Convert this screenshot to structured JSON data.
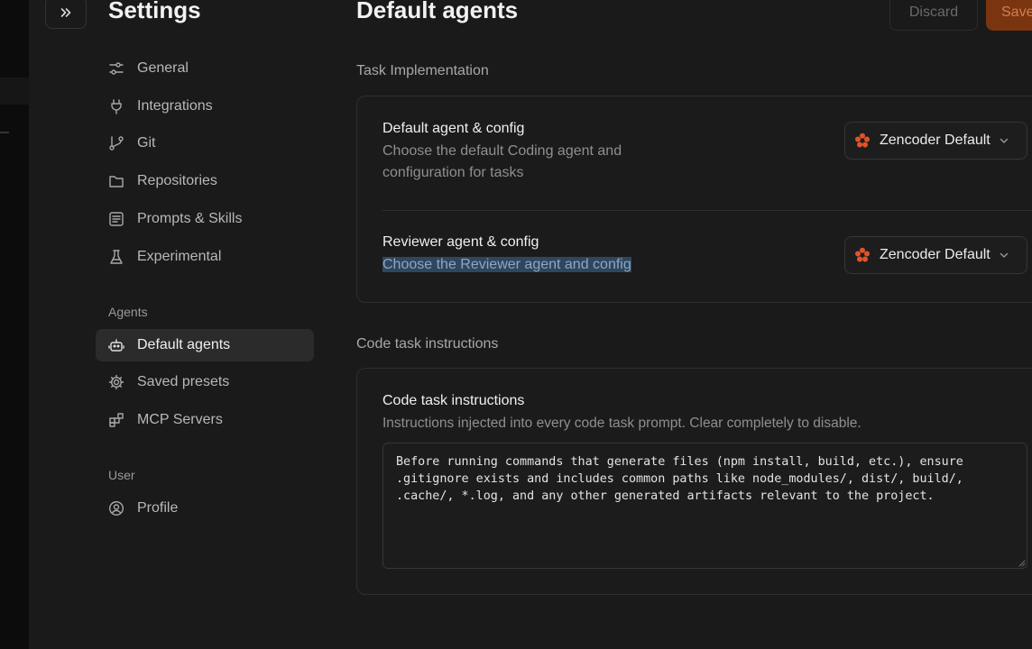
{
  "colors": {
    "background": "#1a1a1a",
    "accent": "#7a3510",
    "zencoder_logo": "#e0542b",
    "highlight": "#2f4660"
  },
  "sidebar": {
    "title": "Settings",
    "collapse_icon": "double-chevron-right-icon",
    "items": [
      {
        "label": "General",
        "icon": "sliders-icon"
      },
      {
        "label": "Integrations",
        "icon": "plug-icon"
      },
      {
        "label": "Git",
        "icon": "git-branch-icon"
      },
      {
        "label": "Repositories",
        "icon": "folder-icon"
      },
      {
        "label": "Prompts & Skills",
        "icon": "document-list-icon"
      },
      {
        "label": "Experimental",
        "icon": "flask-icon"
      }
    ],
    "agents_section": {
      "label": "Agents",
      "items": [
        {
          "label": "Default agents",
          "icon": "robot-icon",
          "active": true
        },
        {
          "label": "Saved presets",
          "icon": "gear-icon"
        },
        {
          "label": "MCP Servers",
          "icon": "blocks-icon"
        }
      ]
    },
    "user_section": {
      "label": "User",
      "items": [
        {
          "label": "Profile",
          "icon": "user-circle-icon"
        }
      ]
    }
  },
  "header": {
    "title": "Default agents",
    "discard_label": "Discard",
    "save_label": "Save"
  },
  "task_implementation": {
    "label": "Task Implementation",
    "rows": [
      {
        "title": "Default agent & config",
        "description_line1": "Choose the default Coding agent and",
        "description_line2": "configuration for tasks",
        "selected_agent": "Zencoder Default"
      },
      {
        "title": "Reviewer agent & config",
        "description": "Choose the Reviewer agent and config",
        "selected_agent": "Zencoder Default"
      }
    ]
  },
  "code_task": {
    "label": "Code task instructions",
    "card_title": "Code task instructions",
    "card_description": "Instructions injected into every code task prompt. Clear completely to disable.",
    "instructions_value": "Before running commands that generate files (npm install, build, etc.), ensure\n.gitignore exists and includes common paths like node_modules/, dist/, build/,\n.cache/, *.log, and any other generated artifacts relevant to the project."
  }
}
